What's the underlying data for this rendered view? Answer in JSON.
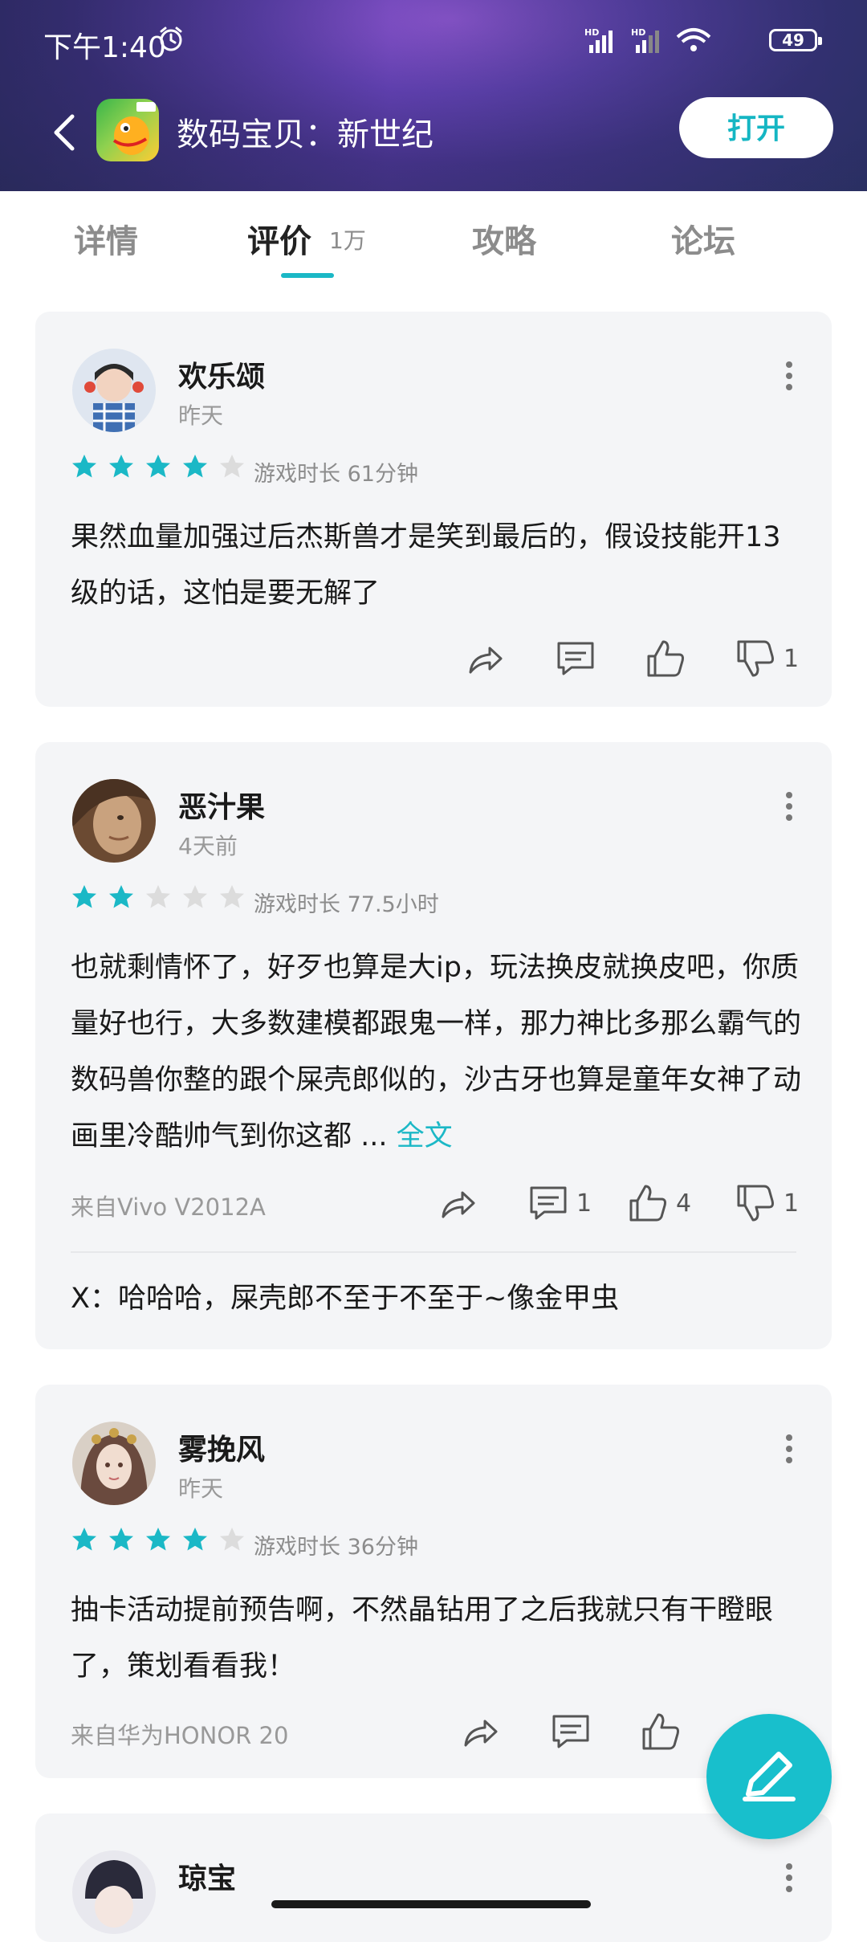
{
  "status": {
    "time": "下午1:40",
    "battery": "49"
  },
  "app": {
    "title": "数码宝贝：新世纪",
    "open_label": "打开"
  },
  "tabs": [
    {
      "label": "详情"
    },
    {
      "label": "评价",
      "badge": "1万"
    },
    {
      "label": "攻略"
    },
    {
      "label": "论坛"
    }
  ],
  "reviews": [
    {
      "user": "欢乐颂",
      "time": "昨天",
      "rating": 4,
      "playtime": "游戏时长 61分钟",
      "content": "果然血量加强过后杰斯兽才是笑到最后的，假设技能开13级的话，这怕是要无解了",
      "dislikes": "1"
    },
    {
      "user": "恶汁果",
      "time": "4天前",
      "rating": 2,
      "playtime": "游戏时长 77.5小时",
      "content": "也就剩情怀了，好歹也算是大ip，玩法换皮就换皮吧，你质量好也行，大多数建模都跟鬼一样，那力神比多那么霸气的数码兽你整的跟个屎壳郎似的，沙古牙也算是童年女神了动画里冷酷帅气到你这都 ... ",
      "full_text": "全文",
      "from": "来自Vivo V2012A",
      "comments": "1",
      "likes": "4",
      "dislikes": "1",
      "reply": "X：哈哈哈，屎壳郎不至于不至于~像金甲虫"
    },
    {
      "user": "雾挽风",
      "time": "昨天",
      "rating": 4,
      "playtime": "游戏时长 36分钟",
      "content": "抽卡活动提前预告啊，不然晶钻用了之后我就只有干瞪眼了，策划看看我！",
      "from": "来自华为HONOR 20"
    },
    {
      "user": "琼宝"
    }
  ],
  "colors": {
    "accent": "#1bb8c6",
    "star_on": "#1bb8c6",
    "star_off": "#dcdcdc"
  },
  "icons": [
    "back-arrow-icon",
    "share-icon",
    "comment-icon",
    "thumbs-up-icon",
    "thumbs-down-icon",
    "more-dots-icon",
    "edit-pen-icon",
    "star-icon"
  ]
}
